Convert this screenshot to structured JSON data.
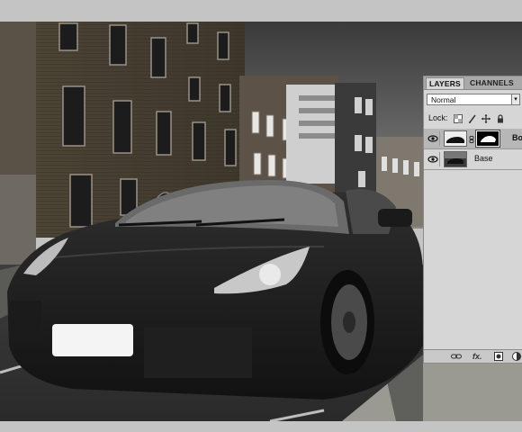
{
  "layers_panel": {
    "tabs": [
      {
        "label": "LAYERS",
        "active": true
      },
      {
        "label": "CHANNELS",
        "active": false
      }
    ],
    "blend_mode": "Normal",
    "lock_label": "Lock:",
    "lock_icons": [
      "lock-transparency-icon",
      "lock-pixels-icon",
      "lock-position-icon",
      "lock-all-icon"
    ],
    "layers": [
      {
        "name": "Bo",
        "selected": true,
        "visible": true,
        "has_mask": true
      },
      {
        "name": "Base",
        "selected": false,
        "visible": true,
        "has_mask": false
      }
    ],
    "footer_icons": [
      "link-layers-icon",
      "fx-icon",
      "add-mask-icon",
      "adjustment-icon"
    ],
    "fx_label": "fx."
  },
  "colors": {
    "panel_bg": "#d6d6d6",
    "tab_bar": "#a9a9a9",
    "selected_row": "#b7b7b7",
    "app_bg": "#c4c4c4"
  }
}
